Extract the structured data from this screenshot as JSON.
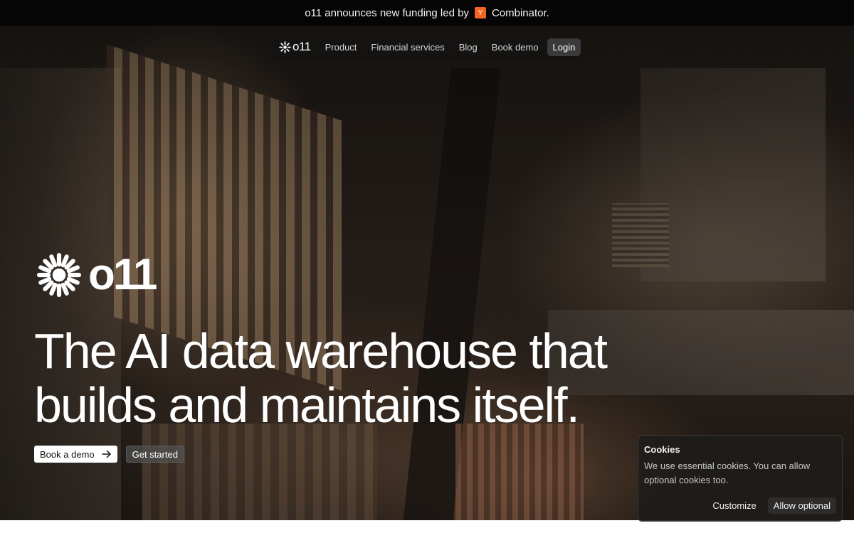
{
  "announcement": {
    "text": "o11 announces new funding led by",
    "badge": "Y",
    "badge_color": "#f26522",
    "combinator": "Combinator."
  },
  "nav": {
    "logo_text": "o11",
    "logo_icon": "sunburst-logo-icon",
    "links": [
      {
        "label": "Product"
      },
      {
        "label": "Financial services"
      },
      {
        "label": "Blog"
      },
      {
        "label": "Book demo"
      }
    ],
    "login_label": "Login"
  },
  "hero": {
    "brand_text": "o11",
    "headline_line1": "The AI data warehouse that",
    "headline_line2": "builds and maintains itself.",
    "primary_cta": "Book a demo",
    "primary_cta_icon": "arrow-right-icon",
    "secondary_cta": "Get started"
  },
  "cookie": {
    "title": "Cookies",
    "text": "We use essential cookies. You can allow optional cookies too.",
    "customize_label": "Customize",
    "allow_label": "Allow optional"
  }
}
